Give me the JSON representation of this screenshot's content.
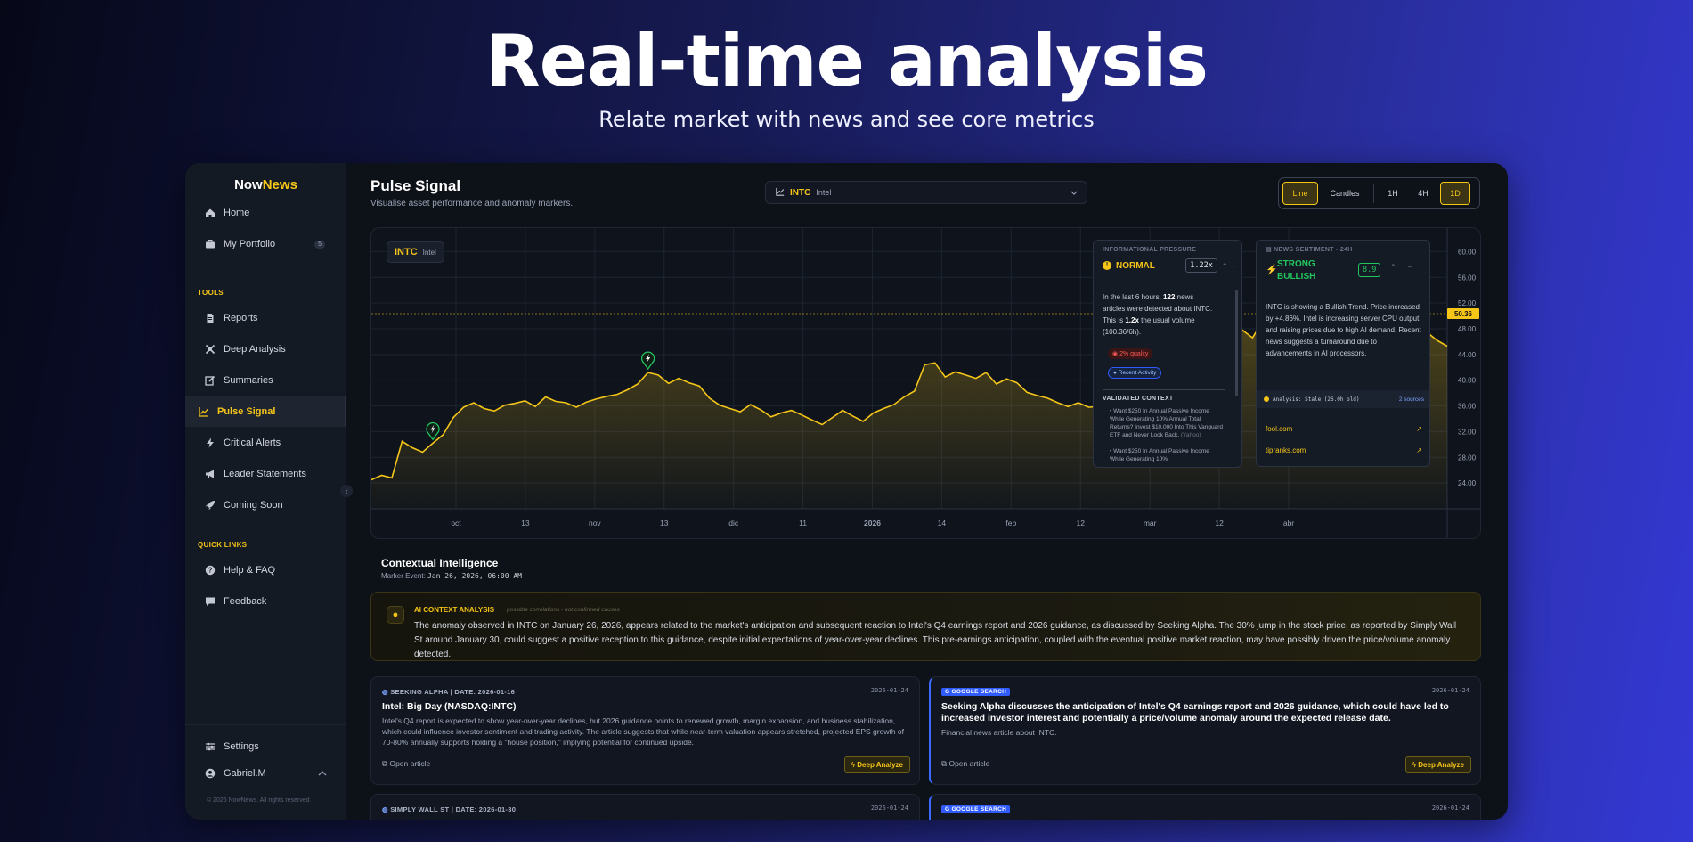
{
  "hero": {
    "title": "Real-time analysis",
    "subtitle": "Relate market with news and see core metrics"
  },
  "brand": {
    "part1": "Now",
    "part2": "News"
  },
  "sidebar": {
    "items": [
      {
        "label": "Home",
        "icon": "home-icon"
      },
      {
        "label": "My Portfolio",
        "icon": "briefcase-icon",
        "badge": "5"
      }
    ],
    "tools_label": "TOOLS",
    "tools": [
      {
        "label": "Reports",
        "icon": "document-icon"
      },
      {
        "label": "Deep Analysis",
        "icon": "analysis-icon"
      },
      {
        "label": "Summaries",
        "icon": "edit-icon"
      },
      {
        "label": "Pulse Signal",
        "icon": "chart-line-icon",
        "active": true
      },
      {
        "label": "Critical Alerts",
        "icon": "bolt-icon"
      },
      {
        "label": "Leader Statements",
        "icon": "megaphone-icon"
      },
      {
        "label": "Coming Soon",
        "icon": "rocket-icon"
      }
    ],
    "quick_label": "QUICK LINKS",
    "quick": [
      {
        "label": "Help & FAQ",
        "icon": "help-icon"
      },
      {
        "label": "Feedback",
        "icon": "chat-icon"
      }
    ],
    "settings": "Settings",
    "user": "Gabriel.M",
    "copyright": "© 2026 NowNews. All rights reserved"
  },
  "header": {
    "title": "Pulse Signal",
    "subtitle": "Visualise asset performance and anomaly markers.",
    "ticker_symbol": "INTC",
    "ticker_name": "Intel",
    "mode_toggles": [
      "Line",
      "Candles"
    ],
    "active_mode": "Line",
    "range_toggles": [
      "1H",
      "4H",
      "1D"
    ],
    "active_range": "1D"
  },
  "chart_data": {
    "type": "area",
    "symbol": "INTC",
    "name": "Intel",
    "x_tick_labels": [
      "oct",
      "13",
      "nov",
      "13",
      "dic",
      "11",
      "2026",
      "14",
      "feb",
      "12",
      "mar",
      "12",
      "abr"
    ],
    "y_tick_labels": [
      "60.00",
      "56.00",
      "52.00",
      "48.00",
      "44.00",
      "40.00",
      "36.00",
      "32.00",
      "28.00",
      "24.00"
    ],
    "ylim": [
      20,
      62
    ],
    "current_price": "50.36",
    "grid": true,
    "accent_color": "#f5c518",
    "values": [
      24.5,
      25.2,
      24.8,
      30.5,
      29.5,
      28.8,
      30.2,
      31.5,
      34.2,
      35.8,
      36.5,
      35.6,
      35.2,
      36.1,
      36.4,
      36.8,
      35.9,
      37.4,
      36.7,
      36.5,
      35.8,
      36.6,
      37.1,
      37.5,
      37.8,
      38.5,
      39.4,
      41.2,
      40.8,
      39.5,
      40.3,
      39.6,
      39.1,
      37.2,
      36.1,
      35.6,
      35.1,
      36.2,
      35.4,
      34.3,
      34.9,
      35.3,
      34.6,
      33.8,
      33.1,
      34.2,
      35.3,
      34.4,
      33.6,
      34.9,
      35.6,
      36.2,
      37.4,
      38.3,
      42.4,
      42.7,
      40.5,
      41.3,
      40.8,
      40.3,
      41.2,
      39.4,
      40.2,
      39.6,
      38.1,
      37.6,
      37.2,
      36.5,
      35.9,
      36.5,
      35.8,
      35.9,
      36.3,
      36.1,
      35.9,
      36.4,
      36.8,
      37.4,
      38.5,
      39.6,
      39.8,
      41.2,
      42.5,
      44.5,
      46.8,
      47.8,
      46.6,
      49.2,
      50.4,
      54.6,
      52.2,
      44.5,
      45.5,
      47.2,
      48.5,
      49.1,
      48.6,
      48.2,
      49.8,
      50.6,
      49.5,
      48.8,
      48.9,
      47.5,
      46.2,
      45.3
    ],
    "markers": [
      {
        "index": 6,
        "kind": "bolt"
      },
      {
        "index": 27,
        "kind": "bolt"
      },
      {
        "index": 77,
        "kind": "bolt"
      },
      {
        "index": 88,
        "kind": "bolt-alert"
      }
    ]
  },
  "info_panel": {
    "label": "INFORMATIONAL PRESSURE",
    "status": "NORMAL",
    "value": "1.22x",
    "text_parts": [
      "In the last 6 hours, ",
      "122",
      " news articles were detected about INTC. This is ",
      "1.2x",
      " the usual volume (100.36/6h)."
    ],
    "quality_badge": "2% quality",
    "activity_badge": "Recent Activity",
    "validated_label": "VALIDATED CONTEXT",
    "validated_items": [
      {
        "text": "Want $250 In Annual Passive Income While Generating 10% Annual Total Returns? Invest $10,000 Into This Vanguard ETF and Never Look Back.",
        "source": "(Yahoo)"
      },
      {
        "text": "Want $250 In Annual Passive Income While Generating 10%",
        "source": ""
      }
    ]
  },
  "sentiment_panel": {
    "label": "NEWS SENTIMENT - 24H",
    "status_line1": "STRONG",
    "status_line2": "BULLISH",
    "value": "8.9",
    "text": "INTC is showing a Bullish Trend. Price increased by +4.86%. Intel is increasing server CPU output and raising prices due to high AI demand. Recent news suggests a turnaround due to advancements in AI processors.",
    "analysis": "Analysis: Stale (26.0h old)",
    "sources_count": "2 sources",
    "sources": [
      "fool.com",
      "tipranks.com"
    ]
  },
  "context": {
    "title": "Contextual Intelligence",
    "marker_label": "Marker Event:",
    "marker_value": "Jan 26, 2026, 06:00 AM",
    "ai_label": "AI CONTEXT ANALYSIS",
    "ai_note": "possible correlations - not confirmed causes",
    "ai_text": "The anomaly observed in INTC on January 26, 2026, appears related to the market's anticipation and subsequent reaction to Intel's Q4 earnings report and 2026 guidance, as discussed by Seeking Alpha. The 30% jump in the stock price, as reported by Simply Wall St around January 30, could suggest a positive reception to this guidance, despite initial expectations of year-over-year declines. This pre-earnings anticipation, coupled with the eventual positive market reaction, may have possibly driven the price/volume anomaly detected."
  },
  "news_cards": [
    {
      "source": "SEEKING ALPHA | DATE: 2026-01-16",
      "date": "2026-01-24",
      "title": "Intel: Big Day (NASDAQ:INTC)",
      "body": "Intel's Q4 report is expected to show year-over-year declines, but 2026 guidance points to renewed growth, margin expansion, and business stabilization, which could influence investor sentiment and trading activity. The article suggests that while near-term valuation appears stretched, projected EPS growth of 70-80% annually supports holding a \"house position,\" implying potential for continued upside.",
      "open": "Open article",
      "deep": "Deep Analyze"
    },
    {
      "badge": "GOOGLE SEARCH",
      "date": "2026-01-24",
      "title": "Seeking Alpha discusses the anticipation of Intel's Q4 earnings report and 2026 guidance, which could have led to increased investor interest and potentially a price/volume anomaly around the expected release date.",
      "body": "Financial news article about INTC.",
      "open": "Open article",
      "deep": "Deep Analyze"
    },
    {
      "source": "SIMPLY WALL ST | DATE: 2026-01-30",
      "date": "2026-01-24"
    },
    {
      "badge": "GOOGLE SEARCH",
      "date": "2026-01-24"
    }
  ]
}
